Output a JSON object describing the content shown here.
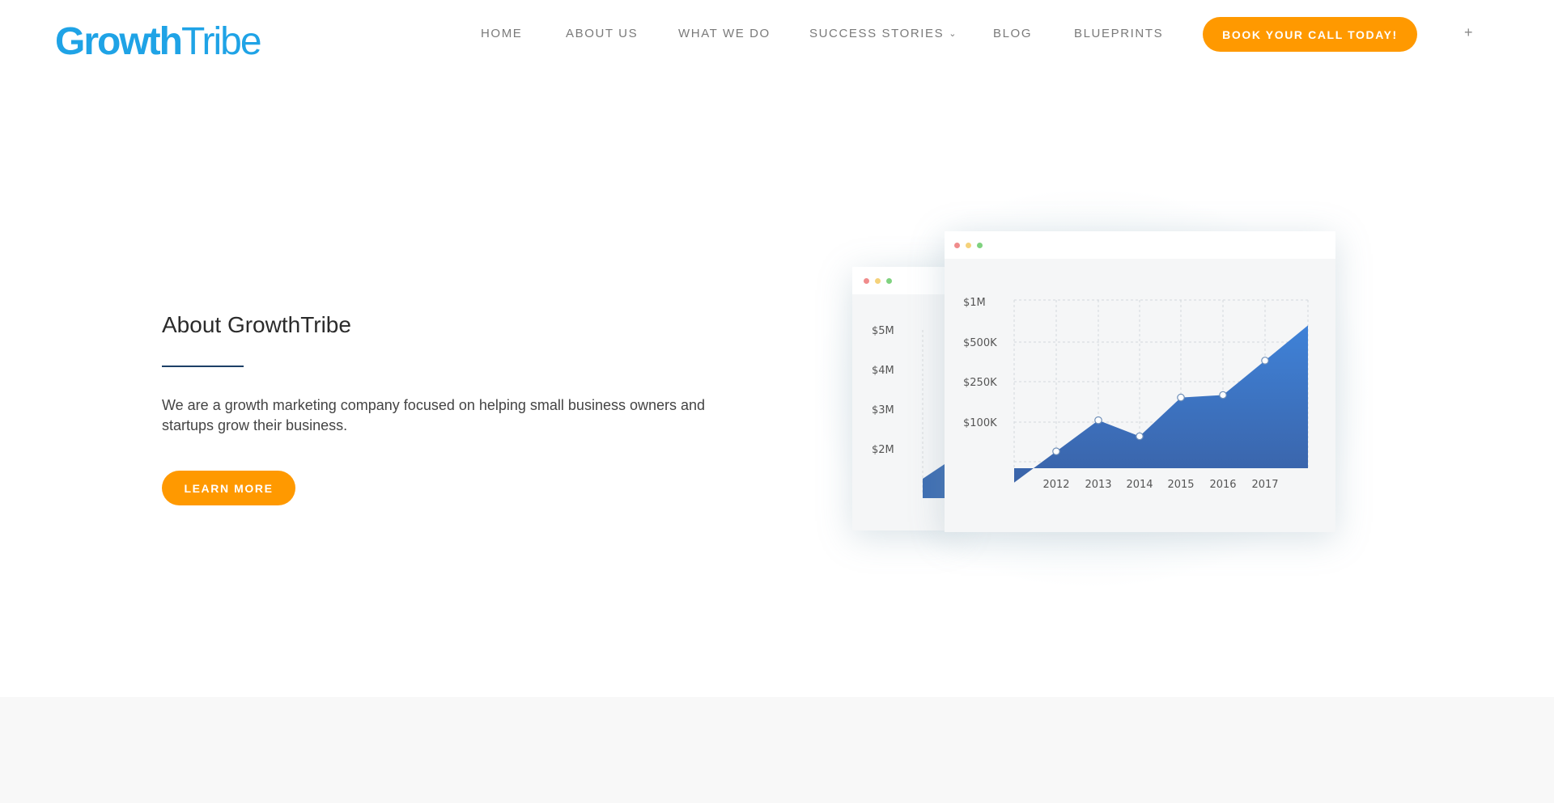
{
  "header": {
    "logo_bold": "Growth",
    "logo_light": "Tribe",
    "nav": [
      {
        "label": "HOME"
      },
      {
        "label": "ABOUT US"
      },
      {
        "label": "WHAT WE DO"
      },
      {
        "label": "SUCCESS STORIES"
      },
      {
        "label": "BLOG"
      },
      {
        "label": "BLUEPRINTS"
      }
    ],
    "cta_label": "BOOK YOUR CALL TODAY!",
    "plus_label": "+"
  },
  "about": {
    "title": "About GrowthTribe",
    "text": "We are a growth marketing company focused on helping small business owners and startups grow their business.",
    "button_label": "LEARN MORE"
  },
  "illustration": {
    "back_labels": [
      "$5M",
      "$4M",
      "$3M",
      "$2M"
    ]
  },
  "chart_data": {
    "type": "area",
    "categories": [
      "2012",
      "2013",
      "2014",
      "2015",
      "2016",
      "2017"
    ],
    "y_tick_labels": [
      "$1M",
      "$500K",
      "$250K",
      "$100K"
    ],
    "series": [
      {
        "values": [
          100,
          285,
          190,
          420,
          435,
          640
        ]
      }
    ],
    "ylim": [
      0,
      1000
    ],
    "grid": true,
    "colors": {
      "fill_top": "#3f82d8",
      "fill_bottom": "#3a63a8",
      "point_fill": "#ffffff"
    }
  },
  "colors": {
    "brand": "#1fa3e6",
    "accent": "#ff9900",
    "rule": "#1c3f66"
  }
}
